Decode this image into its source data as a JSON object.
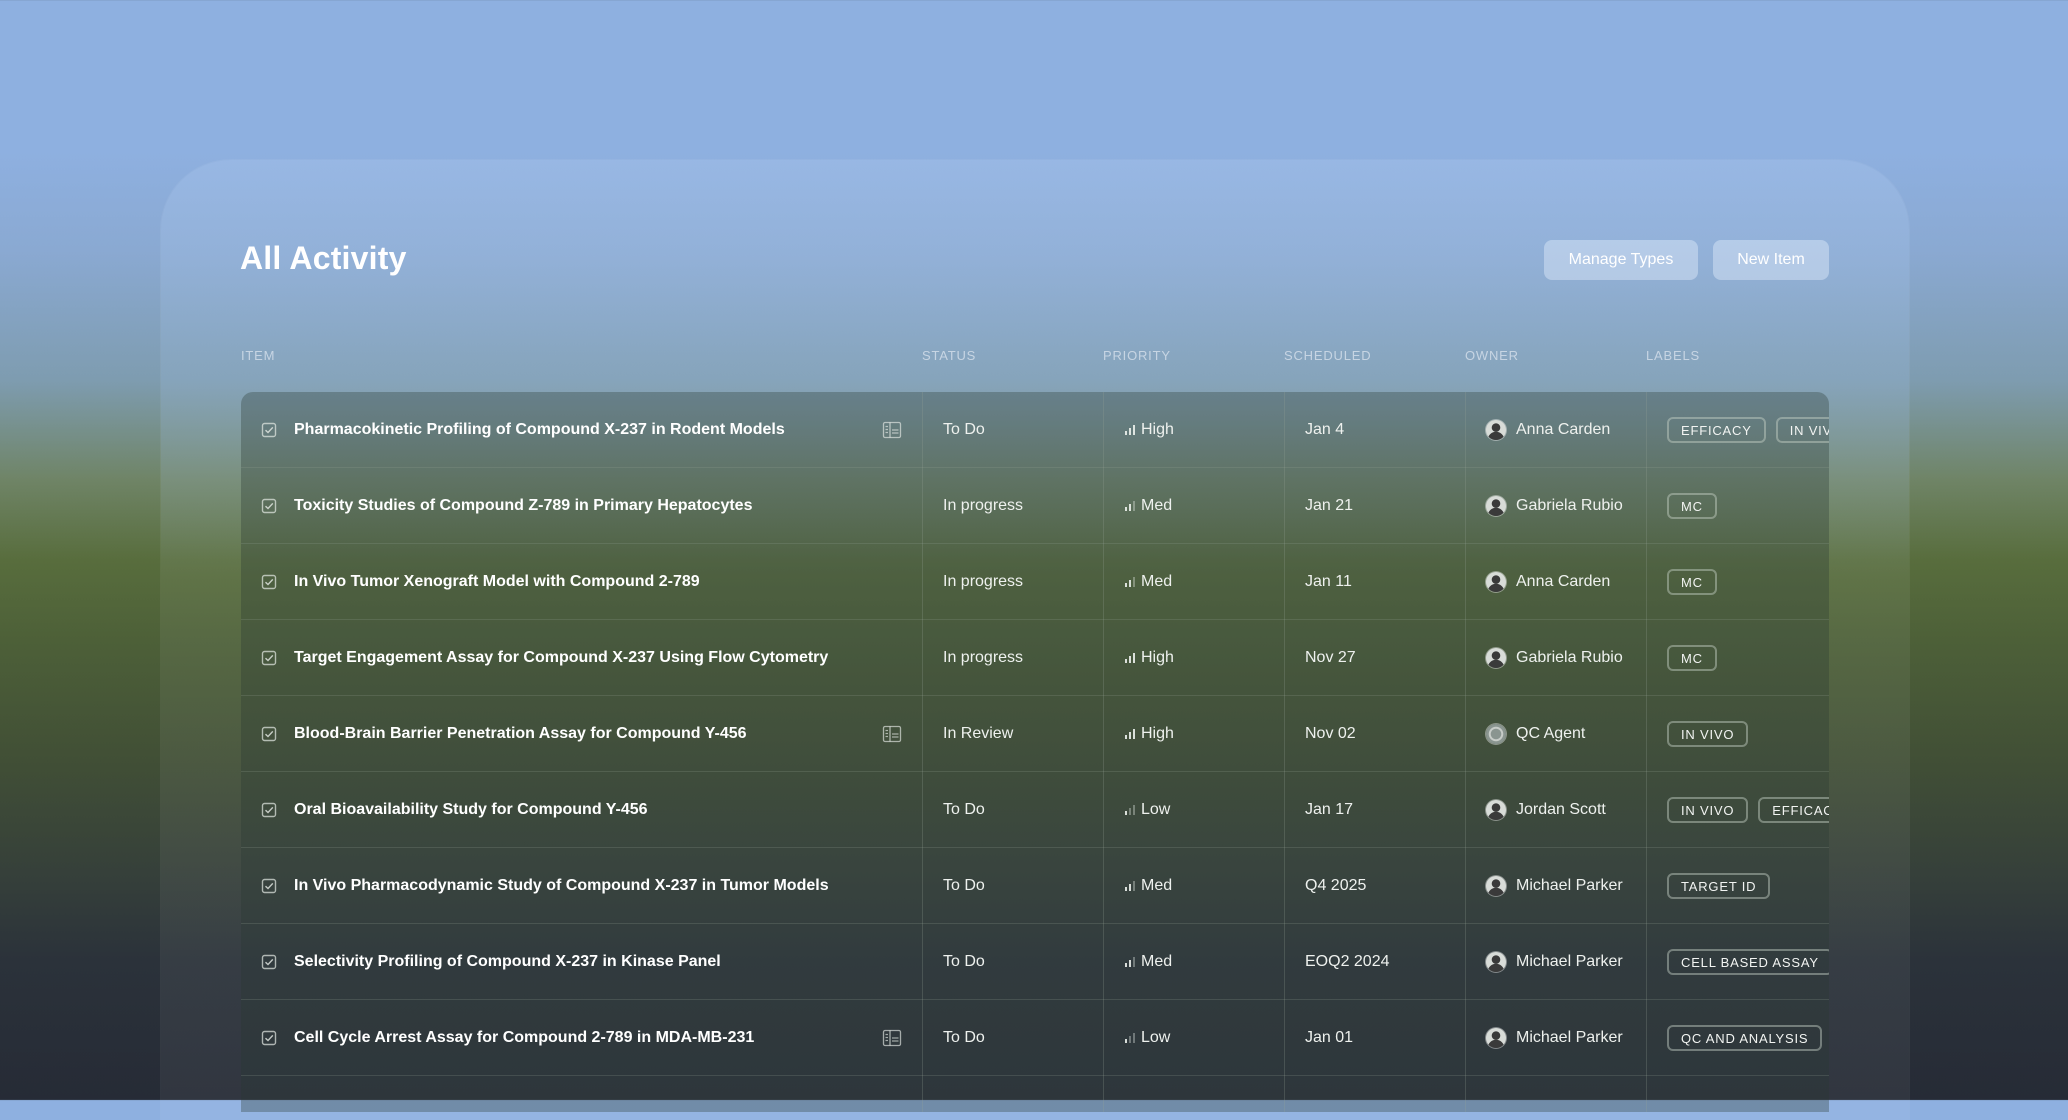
{
  "page": {
    "title": "All Activity",
    "manage_types": "Manage Types",
    "new_item": "New Item"
  },
  "columns": [
    "ITEM",
    "STATUS",
    "PRIORITY",
    "SCHEDULED",
    "OWNER",
    "LABELS"
  ],
  "rows": [
    {
      "title": "Pharmacokinetic Profiling of Compound X-237 in Rodent Models",
      "doc": true,
      "status": "To Do",
      "priority": "High",
      "priority_level": 3,
      "scheduled": "Jan 4",
      "owner": "Anna Carden",
      "agent": false,
      "labels": [
        "EFFICACY",
        "IN VIVO"
      ]
    },
    {
      "title": "Toxicity Studies of Compound Z-789 in Primary Hepatocytes",
      "doc": false,
      "status": "In progress",
      "priority": "Med",
      "priority_level": 2,
      "scheduled": "Jan 21",
      "owner": "Gabriela Rubio",
      "agent": false,
      "labels": [
        "MC"
      ]
    },
    {
      "title": "In Vivo Tumor Xenograft Model with Compound 2-789",
      "doc": false,
      "status": "In progress",
      "priority": "Med",
      "priority_level": 2,
      "scheduled": "Jan 11",
      "owner": "Anna Carden",
      "agent": false,
      "labels": [
        "MC"
      ]
    },
    {
      "title": "Target Engagement Assay for Compound X-237 Using Flow Cytometry",
      "doc": false,
      "status": "In progress",
      "priority": "High",
      "priority_level": 3,
      "scheduled": "Nov 27",
      "owner": "Gabriela Rubio",
      "agent": false,
      "labels": [
        "MC"
      ]
    },
    {
      "title": "Blood-Brain Barrier Penetration Assay for Compound Y-456",
      "doc": true,
      "status": "In Review",
      "priority": "High",
      "priority_level": 3,
      "scheduled": "Nov 02",
      "owner": "QC Agent",
      "agent": true,
      "labels": [
        "IN VIVO"
      ]
    },
    {
      "title": "Oral Bioavailability Study for Compound Y-456",
      "doc": false,
      "status": "To Do",
      "priority": "Low",
      "priority_level": 1,
      "scheduled": "Jan 17",
      "owner": "Jordan Scott",
      "agent": false,
      "labels": [
        "IN VIVO",
        "EFFICACY"
      ]
    },
    {
      "title": "In Vivo Pharmacodynamic Study of Compound X-237 in Tumor Models",
      "doc": false,
      "status": "To Do",
      "priority": "Med",
      "priority_level": 2,
      "scheduled": "Q4 2025",
      "owner": "Michael Parker",
      "agent": false,
      "labels": [
        "TARGET ID"
      ]
    },
    {
      "title": "Selectivity Profiling of Compound X-237 in Kinase Panel",
      "doc": false,
      "status": "To Do",
      "priority": "Med",
      "priority_level": 2,
      "scheduled": "EOQ2 2024",
      "owner": "Michael Parker",
      "agent": false,
      "labels": [
        "CELL BASED ASSAY"
      ]
    },
    {
      "title": "Cell Cycle Arrest Assay for Compound 2-789 in MDA-MB-231",
      "doc": true,
      "status": "To Do",
      "priority": "Low",
      "priority_level": 1,
      "scheduled": "Jan 01",
      "owner": "Michael Parker",
      "agent": false,
      "labels": [
        "QC AND ANALYSIS"
      ]
    },
    {
      "title": "",
      "doc": false,
      "status": "",
      "priority": "",
      "priority_level": 0,
      "scheduled": "",
      "owner": "",
      "agent": false,
      "labels": []
    }
  ],
  "icons": {
    "row_check": "checkbox-icon",
    "doc": "document-icon",
    "priority": "signal-bars-icon",
    "owner": "avatar"
  }
}
